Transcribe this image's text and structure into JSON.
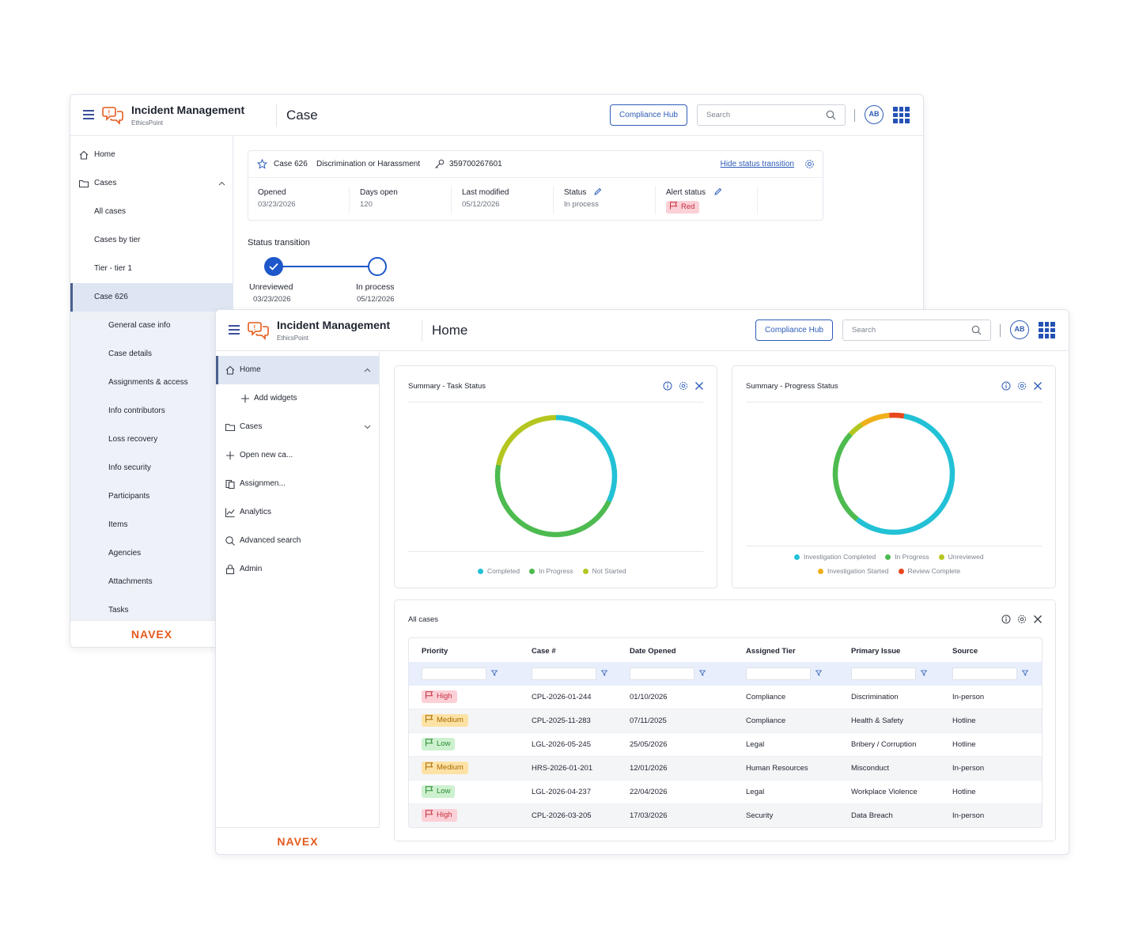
{
  "back_window": {
    "app_title": "Incident Management",
    "app_subtitle": "EthicsPoint",
    "page_title": "Case",
    "compliance_hub": "Compliance Hub",
    "search_placeholder": "Search",
    "avatar": "AB",
    "sidebar": {
      "home": "Home",
      "cases": "Cases",
      "all_cases": "All cases",
      "cases_by_tier": "Cases by tier",
      "tier": "Tier - tier 1",
      "case_626": "Case 626",
      "sub_items": [
        "General case info",
        "Case details",
        "Assignments & access",
        "Info contributors",
        "Loss recovery",
        "Info security",
        "Participants",
        "Items",
        "Agencies",
        "Attachments",
        "Tasks"
      ]
    },
    "footer_logo": "NAVEX",
    "case_card": {
      "case_id": "Case 626",
      "case_type": "Discrimination or Harassment",
      "case_key": "359700267601",
      "hide_link": "Hide status transition",
      "fields": [
        {
          "key": "Opened",
          "value": "03/23/2026"
        },
        {
          "key": "Days open",
          "value": "120"
        },
        {
          "key": "Last modified",
          "value": "05/12/2026"
        },
        {
          "key": "Status",
          "value": "In process"
        },
        {
          "key": "Alert status",
          "value": "Red"
        }
      ]
    },
    "status_transition": {
      "title": "Status transition",
      "steps": [
        {
          "label": "Unreviewed",
          "date": "03/23/2026"
        },
        {
          "label": "In process",
          "date": "05/12/2026"
        }
      ]
    }
  },
  "front_window": {
    "app_title": "Incident Management",
    "app_subtitle": "EthicsPoint",
    "page_title": "Home",
    "compliance_hub": "Compliance Hub",
    "search_placeholder": "Search",
    "avatar": "AB",
    "sidebar": {
      "home": "Home",
      "add_widgets": "Add widgets",
      "cases": "Cases",
      "open_new_case": "Open new ca...",
      "assignments": "Assignmen...",
      "analytics": "Analytics",
      "advanced_search": "Advanced search",
      "admin": "Admin"
    },
    "footer_logo": "NAVEX",
    "widget_task": {
      "title": "Summary - Task Status",
      "legend": [
        "Completed",
        "In Progress",
        "Not Started"
      ]
    },
    "widget_progress": {
      "title": "Summary - Progress Status",
      "legend": [
        "Investigation Completed",
        "In Progress",
        "Unreviewed",
        "Investigation Started",
        "Review Complete"
      ]
    },
    "all_cases": {
      "title": "All cases",
      "columns": [
        "Priority",
        "Case #",
        "Date Opened",
        "Assigned Tier",
        "Primary Issue",
        "Source"
      ],
      "rows": [
        {
          "priority": "High",
          "case": "CPL-2026-01-244",
          "date": "01/10/2026",
          "tier": "Compliance",
          "issue": "Discrimination",
          "source": "In-person"
        },
        {
          "priority": "Medium",
          "case": "CPL-2025-11-283",
          "date": "07/11/2025",
          "tier": "Compliance",
          "issue": "Health & Safety",
          "source": "Hotline"
        },
        {
          "priority": "Low",
          "case": "LGL-2026-05-245",
          "date": "25/05/2026",
          "tier": "Legal",
          "issue": "Bribery / Corruption",
          "source": "Hotline"
        },
        {
          "priority": "Medium",
          "case": "HRS-2026-01-201",
          "date": "12/01/2026",
          "tier": "Human Resources",
          "issue": "Misconduct",
          "source": "In-person"
        },
        {
          "priority": "Low",
          "case": "LGL-2026-04-237",
          "date": "22/04/2026",
          "tier": "Legal",
          "issue": "Workplace Violence",
          "source": "Hotline"
        },
        {
          "priority": "High",
          "case": "CPL-2026-03-205",
          "date": "17/03/2026",
          "tier": "Security",
          "issue": "Data Breach",
          "source": "In-person"
        }
      ]
    }
  },
  "chart_data": [
    {
      "type": "pie",
      "title": "Summary - Task Status",
      "categories": [
        "Completed",
        "In Progress",
        "Not Started"
      ],
      "values": [
        32,
        46,
        22
      ],
      "colors": [
        "#22c1d6",
        "#4dbb4f",
        "#b4c61f"
      ]
    },
    {
      "type": "pie",
      "title": "Summary - Progress Status",
      "categories": [
        "Investigation Completed",
        "In Progress",
        "Unreviewed",
        "Investigation Started",
        "Review Complete"
      ],
      "values": [
        58,
        26,
        4,
        8,
        4
      ],
      "colors": [
        "#22c1d6",
        "#4dbb4f",
        "#b4c61f",
        "#f0b01a",
        "#e8471d"
      ]
    }
  ],
  "colors": {
    "accent": "#2e5cb8",
    "brand_orange": "#e45a1d",
    "priority_high": "#fbd0d6",
    "priority_medium": "#fde2a6",
    "priority_low": "#cdf1cf"
  }
}
